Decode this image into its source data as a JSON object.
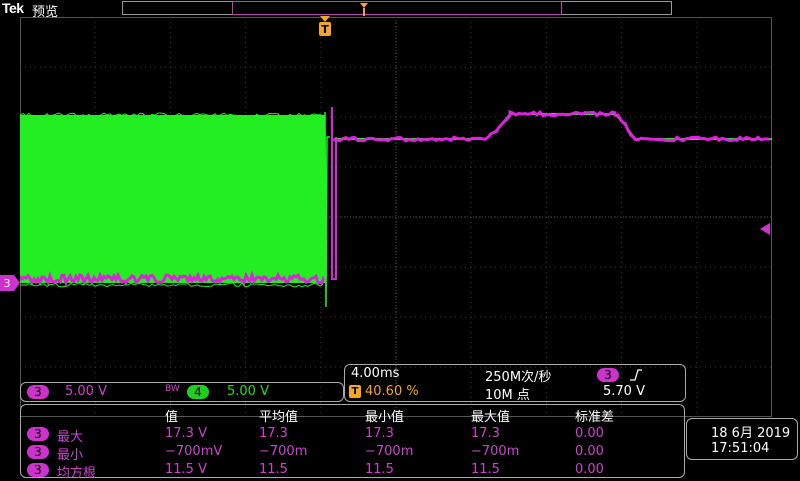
{
  "header": {
    "brand": "Tek",
    "mode": "预览"
  },
  "trigger_marker": "T",
  "ch3_marker": "3",
  "ch_settings": {
    "ch3_num": "3",
    "ch3_scale": "5.00 V",
    "bw_label": "BW",
    "ch4_num": "4",
    "ch4_scale": "5.00 V"
  },
  "timebase": {
    "time_div": "4.00ms",
    "sample_rate": "250M次/秒",
    "trig_icon": "T",
    "trig_pos": "40.60 %",
    "record_len": "10M 点",
    "trig_ch": "3",
    "slope_icon": "rising-edge-icon",
    "trig_level": "5.70 V"
  },
  "measurements": {
    "headers": [
      "值",
      "平均值",
      "最小值",
      "最大值",
      "标准差"
    ],
    "rows": [
      {
        "ch": "3",
        "name": "最大",
        "values": [
          "17.3 V",
          "17.3",
          "17.3",
          "17.3",
          "0.00"
        ]
      },
      {
        "ch": "3",
        "name": "最小",
        "values": [
          "−700mV",
          "−700m",
          "−700m",
          "−700m",
          "0.00"
        ]
      },
      {
        "ch": "3",
        "name": "均方根",
        "values": [
          "11.5 V",
          "11.5",
          "11.5",
          "11.5",
          "0.00"
        ]
      }
    ]
  },
  "datetime": {
    "date": "18 6月 2019",
    "time": "17:51:04"
  },
  "colors": {
    "ch3": "#dd22dd",
    "ch4": "#22ee22",
    "trigger": "#f5a623"
  }
}
